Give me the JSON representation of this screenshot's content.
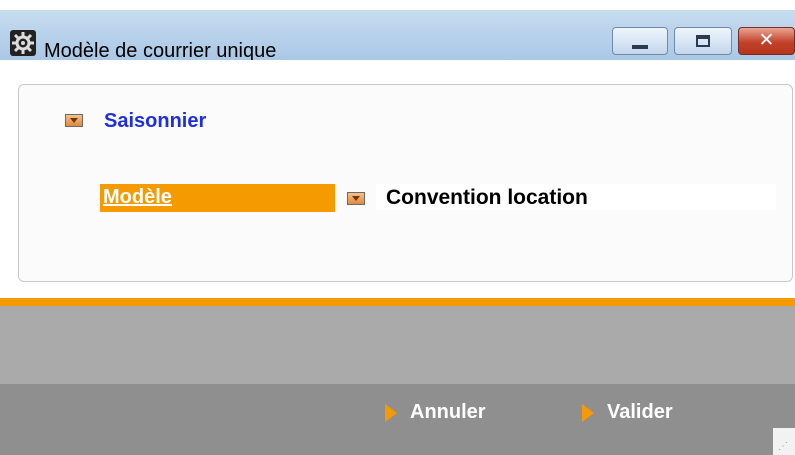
{
  "window": {
    "title": "Modèle de courrier unique",
    "controls": {
      "close_glyph": "✕"
    }
  },
  "section": {
    "label": "Saisonnier"
  },
  "field": {
    "label": "Modèle",
    "value": "Convention location"
  },
  "actions": {
    "cancel_label": "Annuler",
    "submit_label": "Valider"
  },
  "colors": {
    "accent_orange": "#f59a00",
    "link_blue": "#1e2fe0",
    "titlebar": "#b7d1ea",
    "footer_light": "#aaaaaa",
    "footer_dark": "#8f8f8f"
  }
}
